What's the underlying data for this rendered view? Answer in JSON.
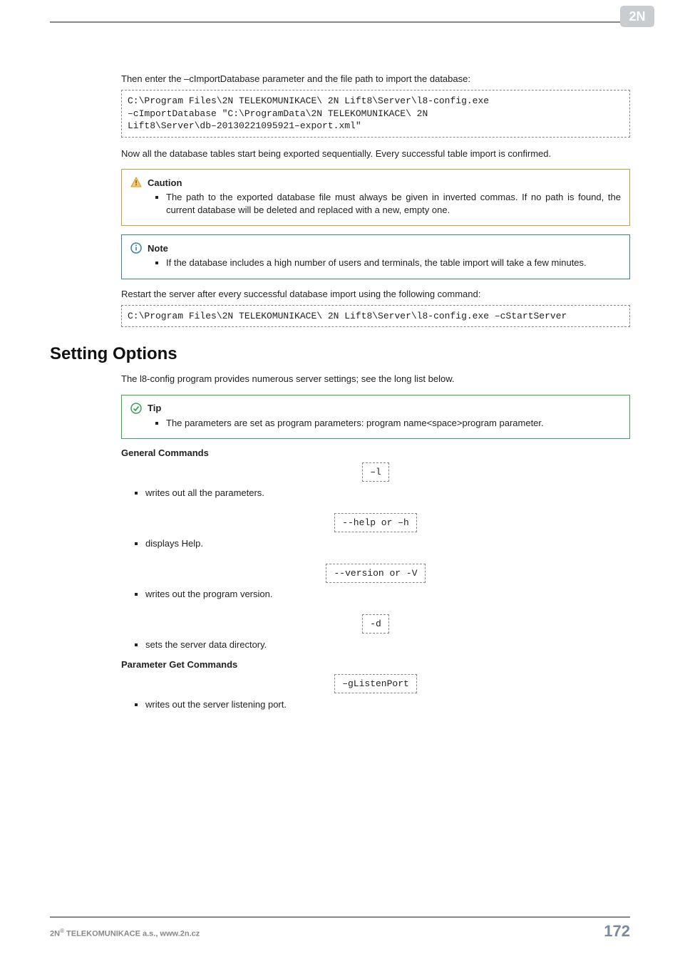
{
  "intro1": "Then enter the –cImportDatabase parameter and the file path to import the database:",
  "code1": "C:\\Program Files\\2N TELEKOMUNIKACE\\ 2N Lift8\\Server\\l8-config.exe\n–cImportDatabase \"C:\\ProgramData\\2N TELEKOMUNIKACE\\ 2N\nLift8\\Server\\db–20130221095921–export.xml\"",
  "intro2": "Now all the database tables start being exported sequentially. Every successful table import is confirmed.",
  "caution": {
    "title": "Caution",
    "item": "The path to the exported database file must always be given in inverted commas. If no path is found, the current database will be deleted and replaced with a new, empty one."
  },
  "note": {
    "title": "Note",
    "item": "If the database includes a high number of users and terminals, the table import will take a few minutes."
  },
  "restart": "Restart the server after every successful database import using the following command:",
  "code2": "C:\\Program Files\\2N TELEKOMUNIKACE\\ 2N Lift8\\Server\\l8-config.exe –cStartServer",
  "h2": "Setting Options",
  "intro3": "The l8-config program provides numerous server settings; see the long list below.",
  "tip": {
    "title": "Tip",
    "item": "The parameters are set as program parameters: program name<space>program parameter."
  },
  "general_heading": "General Commands",
  "commands": {
    "c1": "–l",
    "d1": "writes out all the parameters.",
    "c2": "--help or –h",
    "d2": "displays Help.",
    "c3": "--version or -V",
    "d3": "writes out the program version.",
    "c4": "-d",
    "d4": "sets the server data directory."
  },
  "paramget_heading": "Parameter Get Commands",
  "paramget": {
    "c1": "–gListenPort",
    "d1": "writes out the server listening port."
  },
  "footer": {
    "company_prefix": "2N",
    "company_rest": " TELEKOMUNIKACE a.s., www.2n.cz",
    "page": "172"
  }
}
